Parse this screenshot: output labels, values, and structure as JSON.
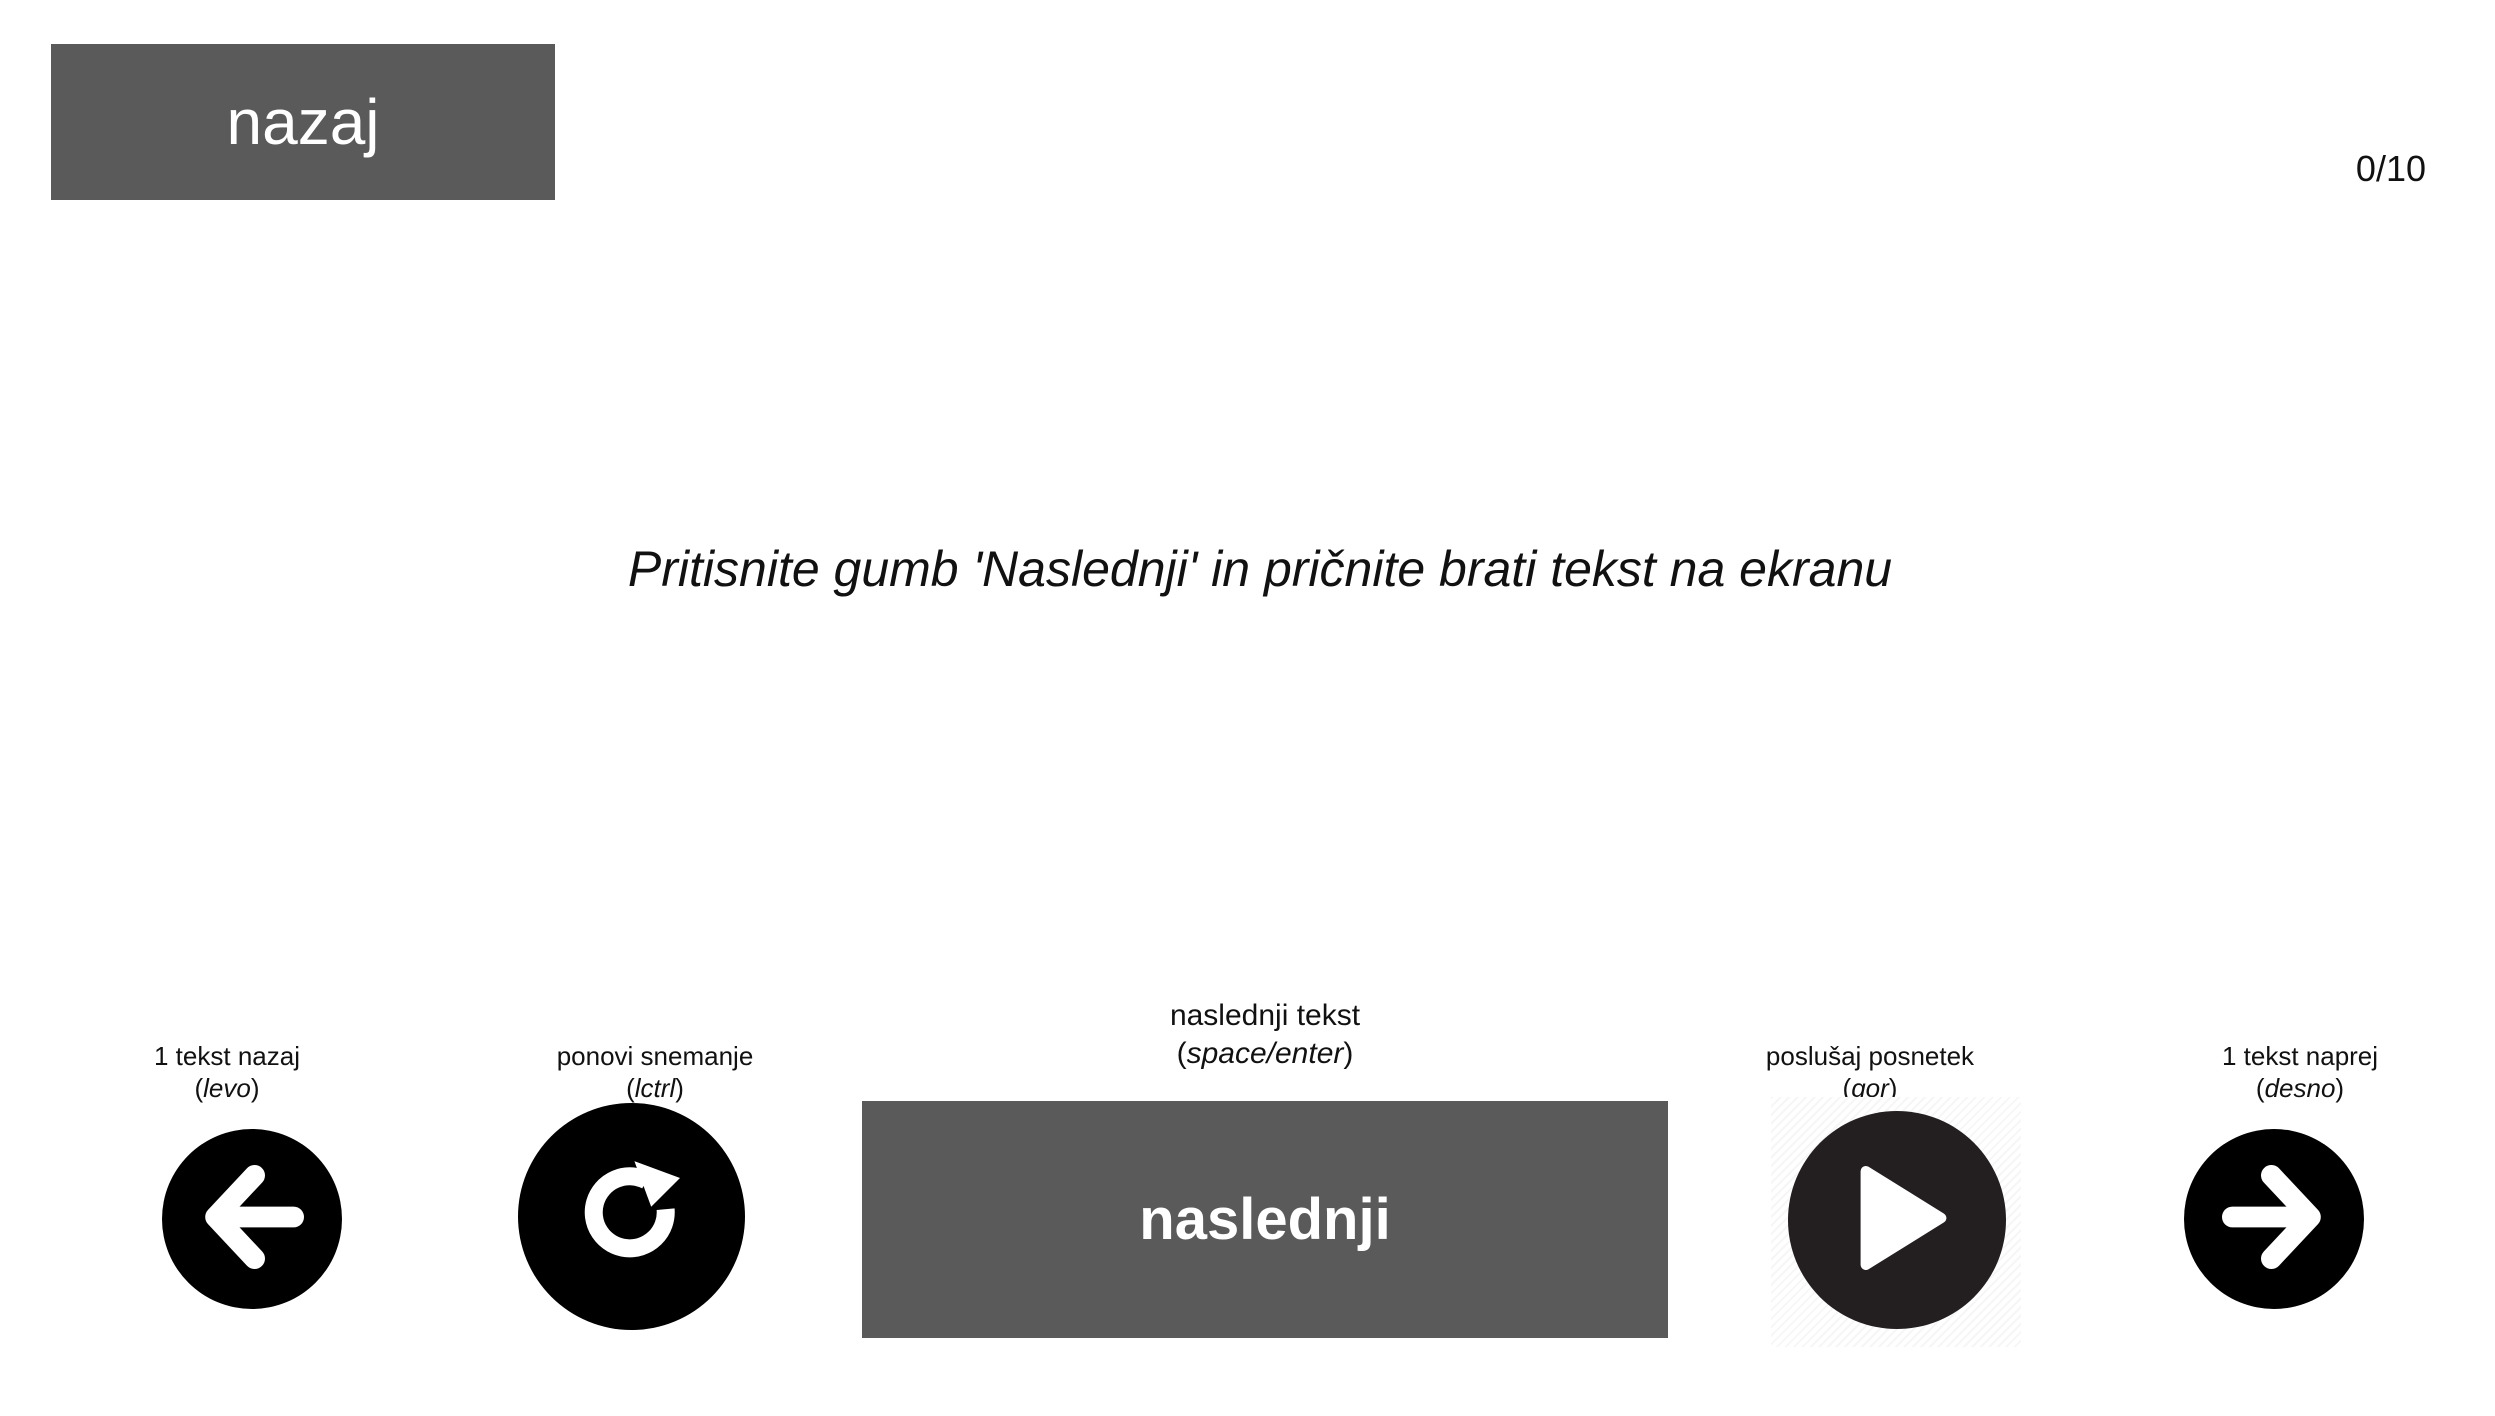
{
  "header": {
    "back_label": "nazaj",
    "progress": "0/10"
  },
  "main": {
    "instruction": "Pritisnite gumb 'Naslednji' in pričnite brati tekst na ekranu"
  },
  "controls": {
    "prev": {
      "label": "1 tekst nazaj",
      "key": "levo",
      "icon": "arrow-left-icon"
    },
    "rerecord": {
      "label": "ponovi snemanje",
      "key": "lctrl",
      "icon": "redo-icon"
    },
    "next": {
      "label": "naslednji tekst",
      "key": "space/enter",
      "button_label": "naslednji"
    },
    "listen": {
      "label": "poslušaj posnetek",
      "key": "gor",
      "icon": "play-icon"
    },
    "forward": {
      "label": "1 tekst naprej",
      "key": "desno",
      "icon": "arrow-right-icon"
    }
  },
  "colors": {
    "button_gray": "#5a5a5a",
    "icon_black": "#000000",
    "background": "#ffffff"
  }
}
